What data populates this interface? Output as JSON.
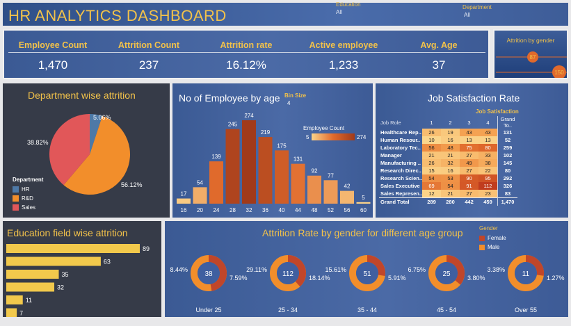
{
  "header": {
    "title": "HR ANALYTICS DASHBOARD",
    "filters": [
      {
        "label": "Education",
        "value": "All"
      },
      {
        "label": "Department",
        "value": "All"
      }
    ]
  },
  "kpis": [
    {
      "label": "Employee Count",
      "value": "1,470"
    },
    {
      "label": "Attrition Count",
      "value": "237"
    },
    {
      "label": "Attrition rate",
      "value": "16.12%"
    },
    {
      "label": "Active employee",
      "value": "1,233"
    },
    {
      "label": "Avg. Age",
      "value": "37"
    }
  ],
  "attrition_by_gender": {
    "title": "Attrition by gender",
    "values": [
      87,
      150
    ]
  },
  "colors": {
    "accent": "#f2c24a",
    "panel_blue": "#4566a1",
    "panel_dark": "#363b48",
    "orange": "#f28e2b",
    "hr_blue": "#4e79a7",
    "sales_red": "#e15759",
    "male": "#f28e2b",
    "female": "#c0462a"
  },
  "chart_data": [
    {
      "type": "pie",
      "title": "Department wise attrition",
      "legend_title": "Department",
      "labels": [
        "HR",
        "R&D",
        "Sales"
      ],
      "values": [
        5.06,
        56.12,
        38.82
      ],
      "value_labels": [
        "5.06%",
        "56.12%",
        "38.82%"
      ],
      "colors": [
        "#4e79a7",
        "#f28e2b",
        "#e15759"
      ],
      "legend_position": "bottom-left"
    },
    {
      "type": "bar",
      "title": "No of Employee by age",
      "bin_size_label": "Bin Size",
      "bin_size": "4",
      "legend_title": "Employee Count",
      "color_range": [
        5,
        274
      ],
      "categories": [
        "16",
        "20",
        "24",
        "28",
        "32",
        "36",
        "40",
        "44",
        "48",
        "52",
        "56",
        "60"
      ],
      "values": [
        17,
        54,
        139,
        245,
        274,
        219,
        175,
        131,
        92,
        77,
        42,
        5
      ]
    },
    {
      "type": "table",
      "title": "Job Satisfaction Rate",
      "column_group": "Job Satisfaction",
      "row_header": "Job Role",
      "columns": [
        "1",
        "2",
        "3",
        "4",
        "Grand To.."
      ],
      "rows": [
        {
          "role": "Healthcare Rep..",
          "values": [
            26,
            19,
            43,
            43
          ],
          "total": "131"
        },
        {
          "role": "Human Resour..",
          "values": [
            10,
            16,
            13,
            13
          ],
          "total": "52"
        },
        {
          "role": "Laboratory Tec..",
          "values": [
            56,
            48,
            75,
            80
          ],
          "total": "259"
        },
        {
          "role": "Manager",
          "values": [
            21,
            21,
            27,
            33
          ],
          "total": "102"
        },
        {
          "role": "Manufacturing ..",
          "values": [
            26,
            32,
            49,
            38
          ],
          "total": "145"
        },
        {
          "role": "Research Direc..",
          "values": [
            15,
            16,
            27,
            22
          ],
          "total": "80"
        },
        {
          "role": "Research Scien..",
          "values": [
            54,
            53,
            90,
            95
          ],
          "total": "292"
        },
        {
          "role": "Sales Executive",
          "values": [
            69,
            54,
            91,
            112
          ],
          "total": "326"
        },
        {
          "role": "Sales Represen..",
          "values": [
            12,
            21,
            27,
            23
          ],
          "total": "83"
        }
      ],
      "grand_total": {
        "label": "Grand Total",
        "values": [
          "289",
          "280",
          "442",
          "459"
        ],
        "total": "1,470"
      }
    },
    {
      "type": "bar",
      "orientation": "horizontal",
      "title": "Education field wise attrition",
      "values": [
        89,
        63,
        35,
        32,
        11,
        7
      ]
    },
    {
      "type": "pie",
      "title": "Attrition Rate by gender for different age group",
      "legend_title": "Gender",
      "legend": [
        "Female",
        "Male"
      ],
      "groups": [
        {
          "label": "Under 25",
          "count": "38",
          "left_pct": "8.44%",
          "right_pct": "7.59%",
          "values": [
            8.44,
            7.59
          ]
        },
        {
          "label": "25 - 34",
          "count": "112",
          "left_pct": "29.11%",
          "right_pct": "18.14%",
          "values": [
            29.11,
            18.14
          ]
        },
        {
          "label": "35 - 44",
          "count": "51",
          "left_pct": "15.61%",
          "right_pct": "5.91%",
          "values": [
            15.61,
            5.91
          ]
        },
        {
          "label": "45 - 54",
          "count": "25",
          "left_pct": "6.75%",
          "right_pct": "3.80%",
          "values": [
            6.75,
            3.8
          ]
        },
        {
          "label": "Over 55",
          "count": "11",
          "left_pct": "3.38%",
          "right_pct": "1.27%",
          "values": [
            3.38,
            1.27
          ]
        }
      ]
    }
  ]
}
